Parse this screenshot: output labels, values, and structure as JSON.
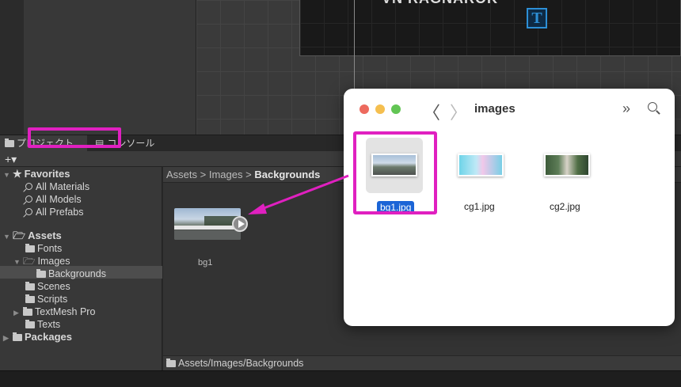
{
  "scene": {
    "canvas_text": "VN RAGNAROK",
    "gizmo_label": "T"
  },
  "project_window": {
    "tabs": [
      {
        "label": "プロジェクト",
        "icon": "folder-icon"
      },
      {
        "label": "コンソール",
        "icon": "console-icon"
      }
    ],
    "toolbar": {
      "add_label": "+▾"
    },
    "tree": {
      "favorites": {
        "label": "Favorites",
        "items": [
          "All Materials",
          "All Models",
          "All Prefabs"
        ]
      },
      "assets": {
        "label": "Assets",
        "fonts": "Fonts",
        "images": "Images",
        "backgrounds": "Backgrounds",
        "scenes": "Scenes",
        "scripts": "Scripts",
        "textmesh": "TextMesh Pro",
        "texts": "Texts"
      },
      "packages": {
        "label": "Packages"
      }
    },
    "breadcrumb": [
      "Assets",
      "Images",
      "Backgrounds"
    ],
    "asset": {
      "name": "bg1"
    },
    "status_path": "Assets/Images/Backgrounds"
  },
  "finder": {
    "title": "images",
    "back_glyph": "〈",
    "forward_glyph": "〉",
    "more_glyph": "»",
    "files": [
      {
        "name": "bg1.jpg",
        "selected": true
      },
      {
        "name": "cg1.jpg",
        "selected": false
      },
      {
        "name": "cg2.jpg",
        "selected": false
      }
    ]
  },
  "annotations": {
    "highlight_color": "#e020c0"
  }
}
